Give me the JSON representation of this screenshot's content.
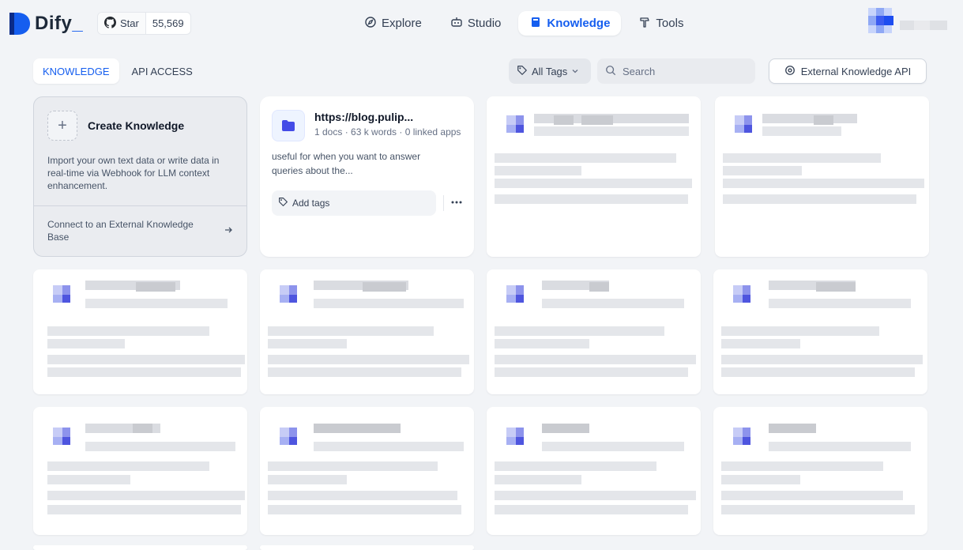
{
  "brand": {
    "name": "Dify",
    "underscore": "_"
  },
  "github": {
    "star_label": "Star",
    "star_count": "55,569"
  },
  "nav": {
    "items": [
      {
        "label": "Explore",
        "icon": "compass-icon",
        "active": false
      },
      {
        "label": "Studio",
        "icon": "robot-icon",
        "active": false
      },
      {
        "label": "Knowledge",
        "icon": "book-icon",
        "active": true
      },
      {
        "label": "Tools",
        "icon": "hammer-icon",
        "active": false
      }
    ]
  },
  "tabs": {
    "knowledge": "KNOWLEDGE",
    "api_access": "API ACCESS",
    "active": "KNOWLEDGE"
  },
  "toolbar": {
    "tags_label": "All Tags",
    "search_placeholder": "Search",
    "external_api_label": "External Knowledge API"
  },
  "create_card": {
    "title": "Create Knowledge",
    "description": "Import your own text data or write data in real-time via Webhook for LLM context enhancement.",
    "connect_label": "Connect to an External Knowledge Base"
  },
  "dataset_card": {
    "name": "https://blog.pulip...",
    "meta": "1 docs · 63 k words · 0 linked apps",
    "description": "useful for when you want to answer queries about the...",
    "add_tags_label": "Add tags"
  },
  "colors": {
    "accent": "#155eef",
    "background": "#f2f4f7"
  }
}
